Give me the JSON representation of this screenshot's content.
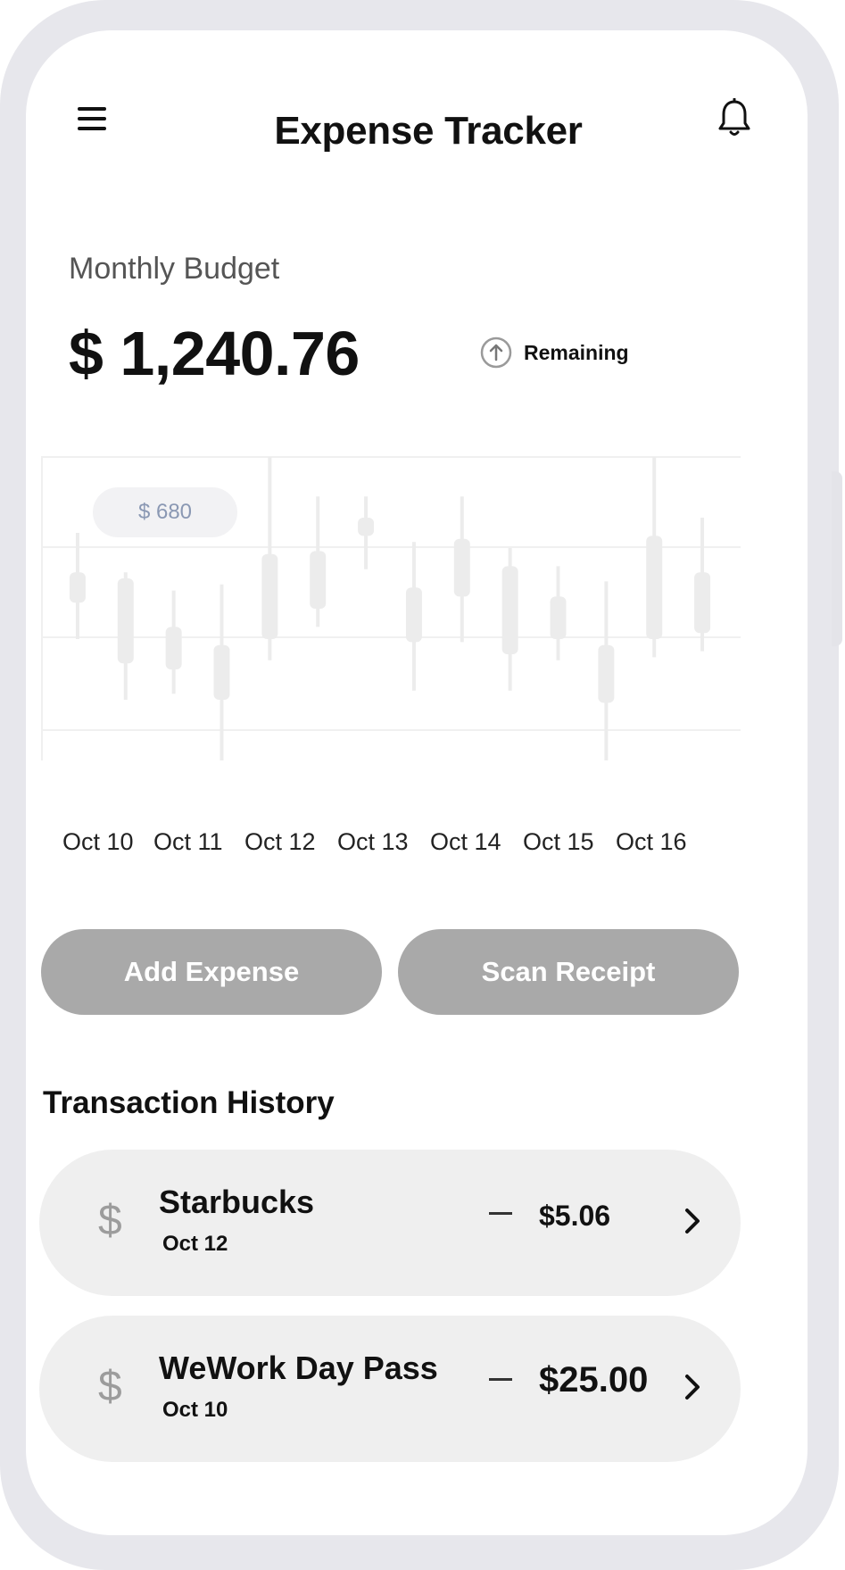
{
  "header": {
    "title": "Expense Tracker",
    "menu_icon": "hamburger-menu-icon",
    "notification_icon": "bell-icon"
  },
  "budget": {
    "label": "Monthly Budget",
    "amount": "$ 1,240.76",
    "status_label": "Remaining",
    "status_icon": "arrow-up-circle-icon"
  },
  "chart_data": {
    "type": "candlestick",
    "tooltip": "$ 680",
    "categories": [
      "Oct 10",
      "Oct 11",
      "Oct 12",
      "Oct 13",
      "Oct 14",
      "Oct 15",
      "Oct 16"
    ],
    "grid": true,
    "candles": [
      {
        "low": 0.4,
        "high": 0.75,
        "open": 0.52,
        "close": 0.62
      },
      {
        "low": 0.2,
        "high": 0.62,
        "open": 0.32,
        "close": 0.6
      },
      {
        "low": 0.22,
        "high": 0.56,
        "open": 0.3,
        "close": 0.44
      },
      {
        "low": 0.0,
        "high": 0.58,
        "open": 0.2,
        "close": 0.38
      },
      {
        "low": 0.33,
        "high": 1.0,
        "open": 0.4,
        "close": 0.68
      },
      {
        "low": 0.44,
        "high": 0.87,
        "open": 0.5,
        "close": 0.69
      },
      {
        "low": 0.63,
        "high": 0.87,
        "open": 0.74,
        "close": 0.8
      },
      {
        "low": 0.23,
        "high": 0.72,
        "open": 0.39,
        "close": 0.57
      },
      {
        "low": 0.39,
        "high": 0.87,
        "open": 0.54,
        "close": 0.73
      },
      {
        "low": 0.23,
        "high": 0.7,
        "open": 0.35,
        "close": 0.64
      },
      {
        "low": 0.33,
        "high": 0.64,
        "open": 0.4,
        "close": 0.54
      },
      {
        "low": 0.0,
        "high": 0.59,
        "open": 0.19,
        "close": 0.38
      },
      {
        "low": 0.34,
        "high": 1.0,
        "open": 0.4,
        "close": 0.74
      },
      {
        "low": 0.36,
        "high": 0.8,
        "open": 0.42,
        "close": 0.62
      }
    ],
    "grid_color": "#f0f0f0",
    "candle_color": "#ececec"
  },
  "actions": {
    "add_expense_label": "Add Expense",
    "scan_receipt_label": "Scan Receipt",
    "button_color": "#a9a9a9"
  },
  "transactions": {
    "title": "Transaction History",
    "items": [
      {
        "icon": "dollar-icon",
        "symbol": "$",
        "name": "Starbucks",
        "date": "Oct 12",
        "amount": "$5.06"
      },
      {
        "icon": "dollar-icon",
        "symbol": "$",
        "name": "WeWork Day Pass",
        "date": "Oct 10",
        "amount": "$25.00"
      }
    ]
  }
}
